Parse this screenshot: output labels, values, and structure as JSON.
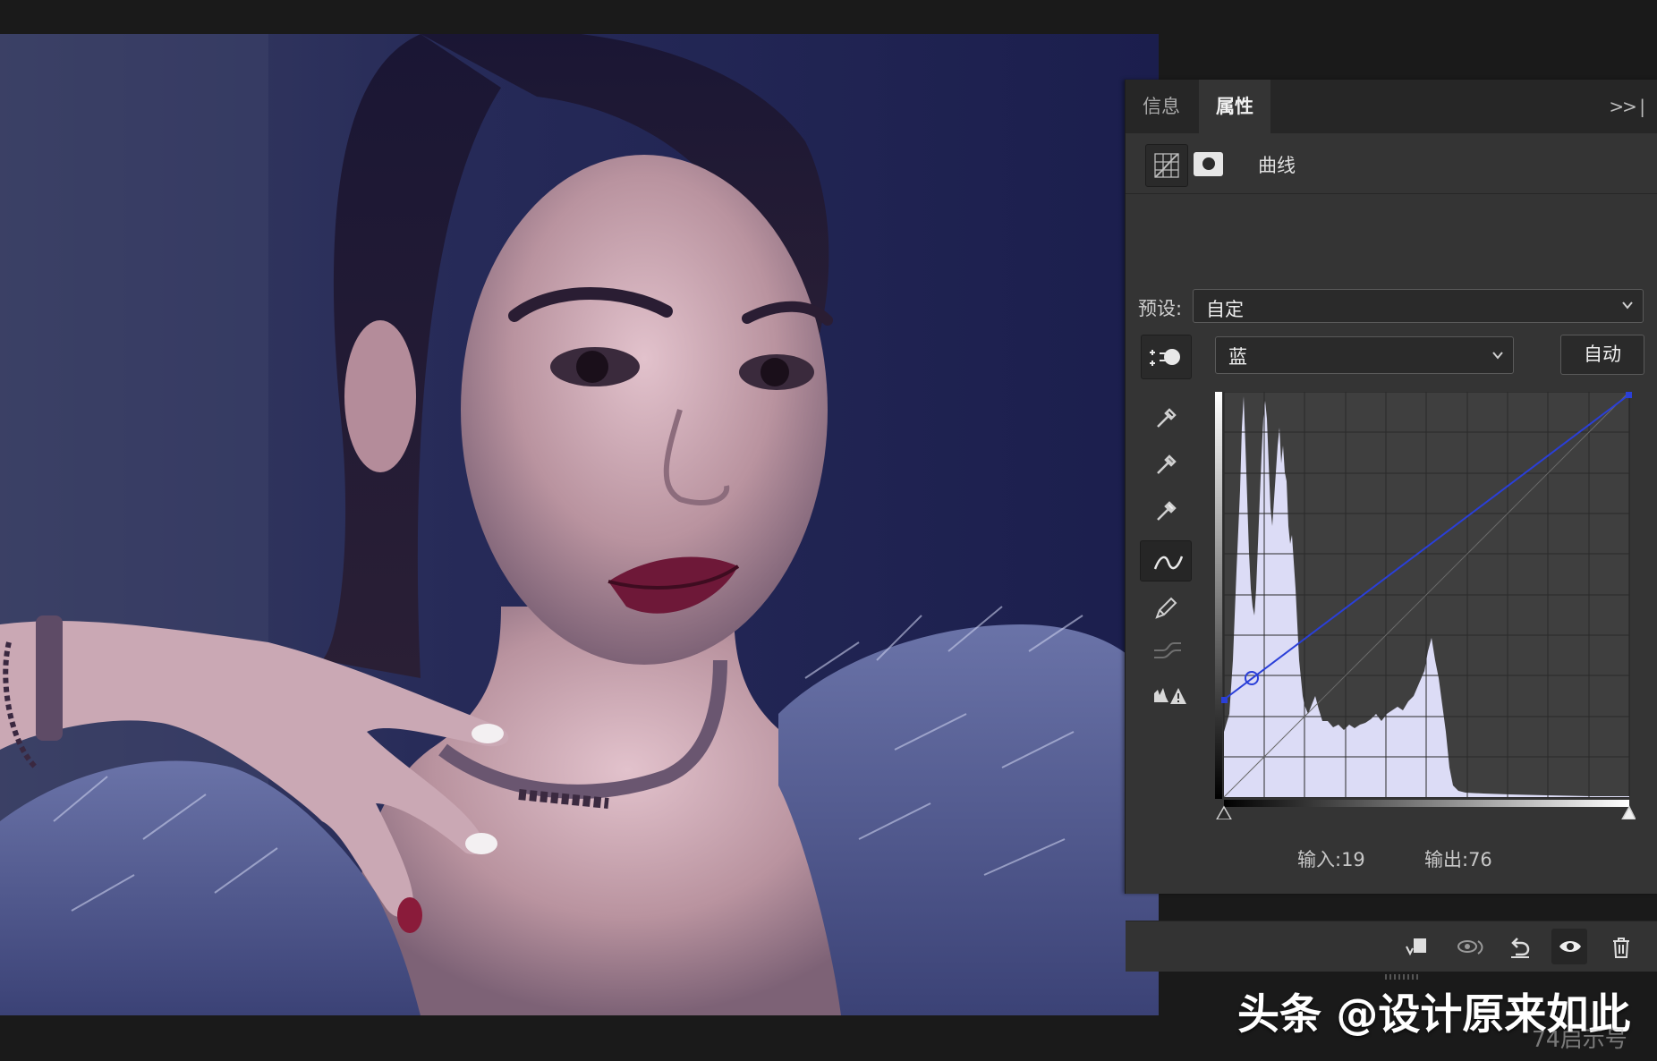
{
  "canvas": {
    "description_name": "portrait-photo"
  },
  "panel": {
    "tabs": [
      {
        "label": "信息",
        "active": false
      },
      {
        "label": "属性",
        "active": true
      }
    ],
    "menu_label": ">>",
    "adjustment_title": "曲线",
    "preset_label": "预设:",
    "preset_value": "自定",
    "channel_value": "蓝",
    "auto_label": "自动",
    "input_readout": "输入:19",
    "output_readout": "输出:76",
    "curve_color": "#2a3fd8",
    "histogram_color": "#dcdcf6",
    "tools": [
      "black-eyedropper-icon",
      "gray-eyedropper-icon",
      "white-eyedropper-icon",
      "curve-points-icon",
      "pencil-icon",
      "smooth-curve-icon",
      "clipping-warning-icon"
    ],
    "bottom_icons": [
      "clip-to-layer-icon",
      "view-previous-state-icon",
      "reset-icon",
      "visibility-eye-icon",
      "trash-icon"
    ]
  },
  "watermark": {
    "main": "头条 @设计原来如此",
    "sub": "74启示号"
  }
}
